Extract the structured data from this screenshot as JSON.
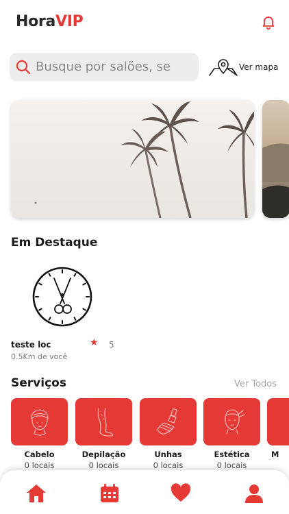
{
  "header": {
    "brand_part1": "Hora",
    "brand_part2": "VIP",
    "bell_icon": "bell-icon"
  },
  "search": {
    "placeholder": "Busque por salões, se",
    "icon": "search-icon"
  },
  "map_button": {
    "label": "Ver mapa",
    "icon": "map-pin-icon"
  },
  "banners": [
    {
      "description": "palm-trees-photo"
    },
    {
      "description": "landscape-photo"
    }
  ],
  "featured": {
    "title": "Em Destaque",
    "items": [
      {
        "name": "teste loc",
        "rating": "5",
        "distance": "0.5Km de você",
        "logo_icon": "scissors-clock-icon",
        "star_icon": "star-icon"
      }
    ]
  },
  "services": {
    "title": "Serviços",
    "see_all": "Ver Todos",
    "items": [
      {
        "name": "Cabelo",
        "count": "0 locais",
        "icon": "hair-towel-icon"
      },
      {
        "name": "Depilação",
        "count": "0 locais",
        "icon": "leg-icon"
      },
      {
        "name": "Unhas",
        "count": "0 locais",
        "icon": "nail-polish-icon"
      },
      {
        "name": "Estética",
        "count": "0 locais",
        "icon": "face-care-icon"
      },
      {
        "name": "M",
        "count": "",
        "icon": "partial-service-icon"
      }
    ]
  },
  "tabbar": {
    "items": [
      {
        "name": "home",
        "icon": "home-icon"
      },
      {
        "name": "calendar",
        "icon": "calendar-icon"
      },
      {
        "name": "favorites",
        "icon": "heart-icon"
      },
      {
        "name": "profile",
        "icon": "user-icon"
      }
    ]
  },
  "colors": {
    "accent": "#e53935",
    "text": "#1c1c1c",
    "muted": "#7a7a7a",
    "search_bg": "#ededed"
  }
}
